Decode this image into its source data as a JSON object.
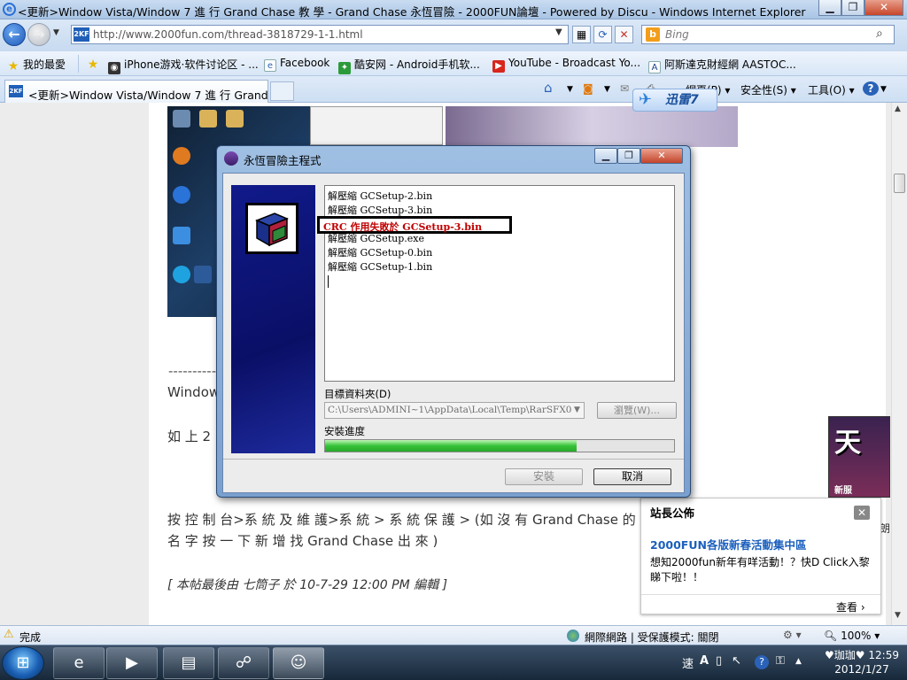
{
  "window": {
    "title": "<更新>Window Vista/Window 7 進 行 Grand Chase 教 學 - Grand Chase 永恆冒險 - 2000FUN論壇 - Powered by Discu - Windows Internet Explorer",
    "min": "▁",
    "max": "❐",
    "close": "✕"
  },
  "address": {
    "favicon": "2KF",
    "url": "http://www.2000fun.com/thread-3818729-1-1.html",
    "search_placeholder": "Bing",
    "search_engine_icon": "b"
  },
  "favorites": {
    "label": "我的最愛",
    "items": [
      {
        "label": "iPhone游戏·软件讨论区 - ..."
      },
      {
        "label": "Facebook"
      },
      {
        "label": "酷安网 - Android手机软..."
      },
      {
        "label": "YouTube - Broadcast Yo..."
      },
      {
        "label": "阿斯達克財經網 AASTOC..."
      }
    ]
  },
  "tabs": [
    {
      "label": "<更新>Window Vista/Window 7 進 行 Grand C..."
    }
  ],
  "commandbar": {
    "page": "網頁(P)",
    "safety": "安全性(S)",
    "tools": "工具(O)",
    "help": "?"
  },
  "xunlei": {
    "label": "迅雷7"
  },
  "page": {
    "separator": "--------------------------",
    "line1": "Window",
    "line2": "如 上 2",
    "para1": "按 控 制 台>系 統 及 維 護>系 統 > 系 統 保 護 > (如 沒 有 Grand Chase 的",
    "para2": "名 字 按 一 下  新 增 找 Grand Chase  出 來 )",
    "edit_note": "[ 本帖最後由 七筒子 於 10-7-29 12:00 PM 編輯 ]",
    "side_char": "朗",
    "ad_label": "新服"
  },
  "notice": {
    "title": "站長公佈",
    "link": "2000FUN各版新春活動集中區",
    "body": "想知2000fun新年有咩活動！？快D Click入黎睇下啦！！",
    "more": "查看 ›",
    "close": "✕"
  },
  "dialog": {
    "title": "永恆冒險主程式",
    "log": [
      "解壓縮 GCSetup-2.bin",
      "解壓縮 GCSetup-3.bin",
      "",
      "解壓縮 GCSetup.exe",
      "解壓縮 GCSetup-0.bin",
      "解壓縮 GCSetup-1.bin"
    ],
    "error_line": "CRC 作用失敗於 GCSetup-3.bin",
    "dest_label": "目標資料夾(D)",
    "dest_path": "C:\\Users\\ADMINI~1\\AppData\\Local\\Temp\\RarSFX0",
    "browse": "瀏覽(W)...",
    "progress_label": "安裝進度",
    "progress": 0.72,
    "install": "安裝",
    "cancel": "取消"
  },
  "status": {
    "text": "完成",
    "zone": "網際網路 | 受保護模式: 關閉",
    "zoom": "100%"
  },
  "taskbar": {
    "time": "12:59",
    "date": "2012/1/27",
    "user": "♥珈珈♥"
  },
  "colors": {
    "error": "#c00000",
    "progress": "#36c338",
    "banner": "#0a0f66"
  }
}
